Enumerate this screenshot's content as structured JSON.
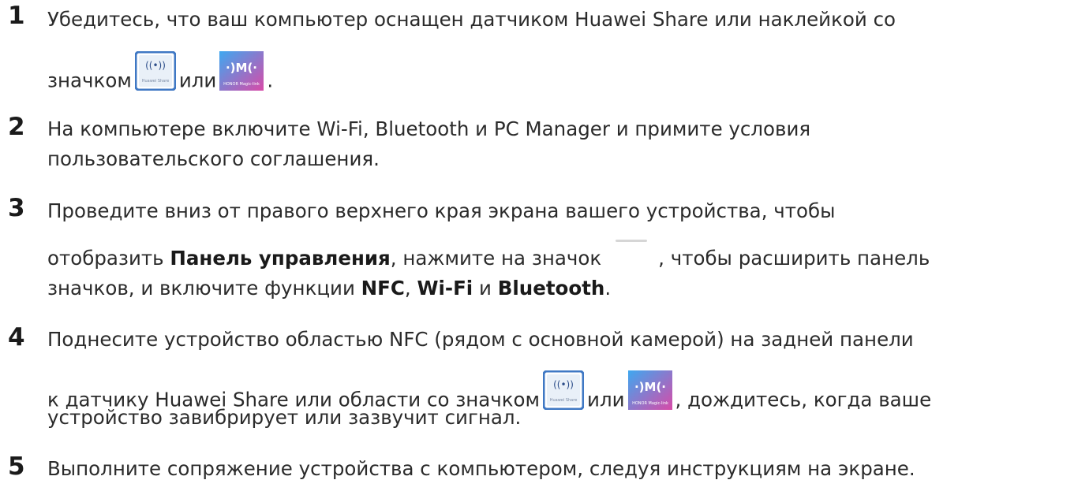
{
  "steps": [
    {
      "number": "1",
      "line1": "Убедитесь, что ваш компьютер оснащен датчиком Huawei Share или наклейкой со",
      "line2_a": "значком",
      "line2_b": "или",
      "line2_c": "."
    },
    {
      "number": "2",
      "line1": "На компьютере включите Wi-Fi, Bluetooth и PC Manager и примите условия",
      "line2": "пользовательского соглашения."
    },
    {
      "number": "3",
      "line1": "Проведите вниз от правого верхнего края экрана вашего устройства, чтобы",
      "line2_a": "отобразить ",
      "line2_bold1": "Панель управления",
      "line2_b": ", нажмите на значок",
      "line2_c": ", чтобы расширить панель",
      "line3_a": "значков, и включите функции ",
      "line3_bold1": "NFC",
      "line3_b": ", ",
      "line3_bold2": "Wi-Fi",
      "line3_c": " и ",
      "line3_bold3": "Bluetooth",
      "line3_d": "."
    },
    {
      "number": "4",
      "line1": "Поднесите устройство областью NFC (рядом с основной камерой) на задней панели",
      "line2_a": "к датчику Huawei Share или области со значком",
      "line2_b": "или",
      "line2_c": ", дождитесь, когда ваше",
      "line3": "устройство завибрирует или зазвучит сигнал."
    },
    {
      "number": "5",
      "line1": "Выполните сопряжение устройства с компьютером, следуя инструкциям на экране."
    }
  ],
  "icons": {
    "huawei_share_label": "Huawei Share",
    "huawei_share_glyph": "((•))",
    "honor_magic_label": "HONOR Magic-link",
    "honor_magic_glyph": "·)M(·",
    "colors": {
      "huawei_share_frame": "#3f78c4",
      "honor_magic_gradient_start": "#3ea8f0",
      "honor_magic_gradient_end": "#d84aa8"
    }
  }
}
